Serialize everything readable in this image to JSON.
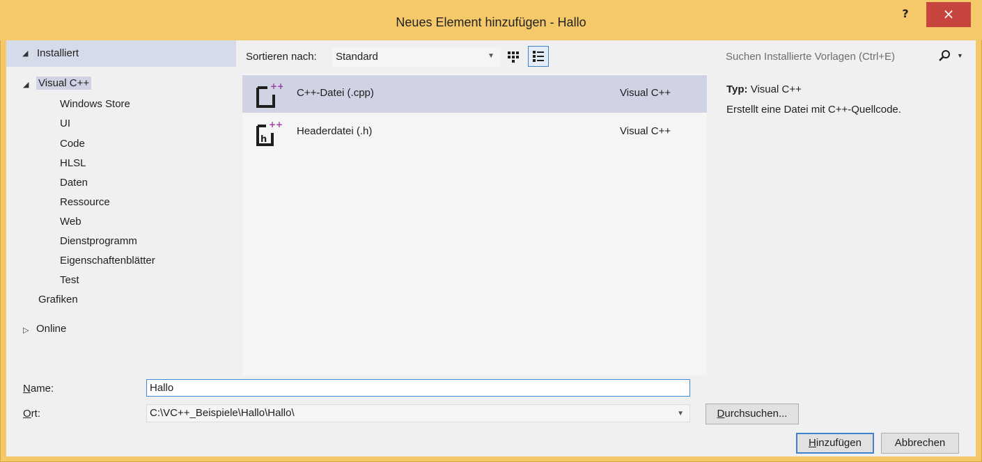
{
  "window": {
    "title": "Neues Element hinzufügen - Hallo",
    "help_label": "?",
    "close_label": "×"
  },
  "tree": {
    "root_label": "Installiert",
    "root_arrow": "◢",
    "visual_cpp_arrow": "◢",
    "visual_cpp_label": "Visual C++",
    "children": [
      "Windows Store",
      "UI",
      "Code",
      "HLSL",
      "Daten",
      "Ressource",
      "Web",
      "Dienstprogramm",
      "Eigenschaftenblätter",
      "Test"
    ],
    "grafiken_label": "Grafiken",
    "online_arrow": "▷",
    "online_label": "Online"
  },
  "toolbar": {
    "sort_label": "Sortieren nach:",
    "sort_value": "Standard"
  },
  "templates": [
    {
      "name": "C++-Datei (.cpp)",
      "language": "Visual C++",
      "icon": "cpp-file-icon",
      "selected": true
    },
    {
      "name": "Headerdatei (.h)",
      "language": "Visual C++",
      "icon": "header-file-icon",
      "selected": false
    }
  ],
  "search": {
    "placeholder": "Suchen Installierte Vorlagen (Ctrl+E)"
  },
  "details": {
    "type_label": "Typ:",
    "type_value": "Visual C++",
    "description": "Erstellt eine Datei mit C++-Quellcode."
  },
  "form": {
    "name_label_first": "N",
    "name_label_rest": "ame:",
    "name_value": "Hallo",
    "ort_label_first": "O",
    "ort_label_rest": "rt:",
    "ort_value": "C:\\VC++_Beispiele\\Hallo\\Hallo\\"
  },
  "buttons": {
    "browse_first": "D",
    "browse_rest": "urchsuchen...",
    "add_first": "H",
    "add_rest": "inzufügen",
    "cancel": "Abbrechen"
  },
  "colors": {
    "titlebar": "#f5c96a",
    "close": "#c7453f",
    "selection": "#cfd3e3",
    "accent": "#3e7fcf",
    "cpp_icon_accent": "#9b3fa3"
  }
}
